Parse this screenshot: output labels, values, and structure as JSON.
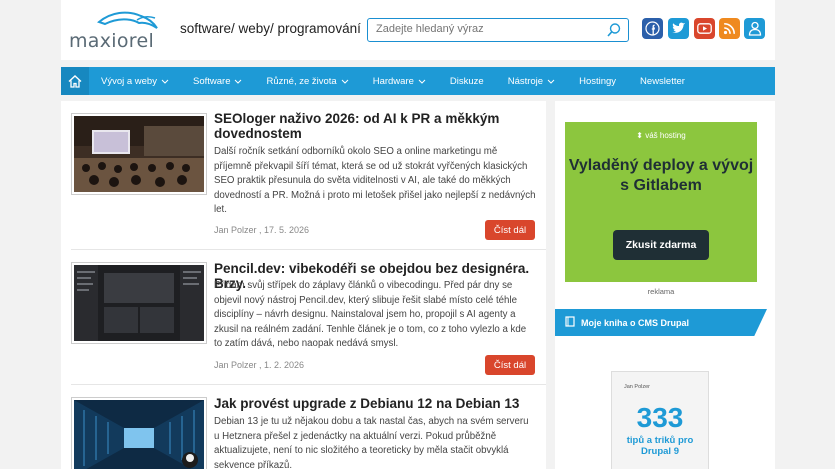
{
  "header": {
    "logo_text": "maxiorel",
    "tagline": "software/ weby/ programování",
    "search_placeholder": "Zadejte hledaný výraz"
  },
  "nav": {
    "items": [
      {
        "label": "Vývoj a weby",
        "dropdown": true
      },
      {
        "label": "Software",
        "dropdown": true
      },
      {
        "label": "Různé, ze života",
        "dropdown": true
      },
      {
        "label": "Hardware",
        "dropdown": true
      },
      {
        "label": "Diskuze",
        "dropdown": false
      },
      {
        "label": "Nástroje",
        "dropdown": true
      },
      {
        "label": "Hostingy",
        "dropdown": false
      },
      {
        "label": "Newsletter",
        "dropdown": false
      }
    ]
  },
  "articles": [
    {
      "title": "SEOloger naživo 2026: od AI k PR a měkkým dovednostem",
      "text": "Další ročník setkání odborníků okolo SEO a online marketingu mě příjemně překvapil šíří témat, která se od už stokrát vyřčených klasických SEO praktik přesunula do světa viditelnosti v AI, ale také do měkkých dovedností a PR. Možná i proto mi letošek přišel jako nejlepší z nedávných let.",
      "meta": "Jan Polzer , 17. 5. 2026",
      "button": "Číst dál"
    },
    {
      "title": "Pencil.dev: vibekodéři se obejdou bez designéra. Brzy.",
      "text": "Přidám svůj střípek do záplavy článků o vibecodingu. Před pár dny se objevil nový nástroj Pencil.dev, který slibuje řešit slabé místo celé téhle disciplíny – návrh designu. Nainstaloval jsem ho, propojil s AI agenty a zkusil na reálném zadání. Tenhle článek je o tom, co z toho vylezlo a kde to zatím dává, nebo naopak nedává smysl.",
      "meta": "Jan Polzer , 1. 2. 2026",
      "button": "Číst dál"
    },
    {
      "title": "Jak provést upgrade z Debianu 12 na Debian 13",
      "text": "Debian 13 je tu už nějakou dobu a tak nastal čas, abych na svém serveru u Hetznera přešel z jedenáctky na aktuální verzi. Pokud průběžně aktualizujete, není to nic složitého a teoreticky by měla stačit obvyklá sekvence příkazů."
    }
  ],
  "sidebar": {
    "ad_brand": "váš hosting",
    "ad_title": "Vyladěný deploy a vývoj s Gitlabem",
    "ad_button": "Zkusit zdarma",
    "ad_label": "reklama",
    "book_section_title": "Moje kniha o CMS Drupal",
    "book_author": "Jan Polzer",
    "book_number": "333",
    "book_subtitle": "tipů a triků pro Drupal 9"
  },
  "colors": {
    "accent": "#1e9ad6",
    "button_red": "#d9462c",
    "ad_green": "#8cc63e"
  }
}
